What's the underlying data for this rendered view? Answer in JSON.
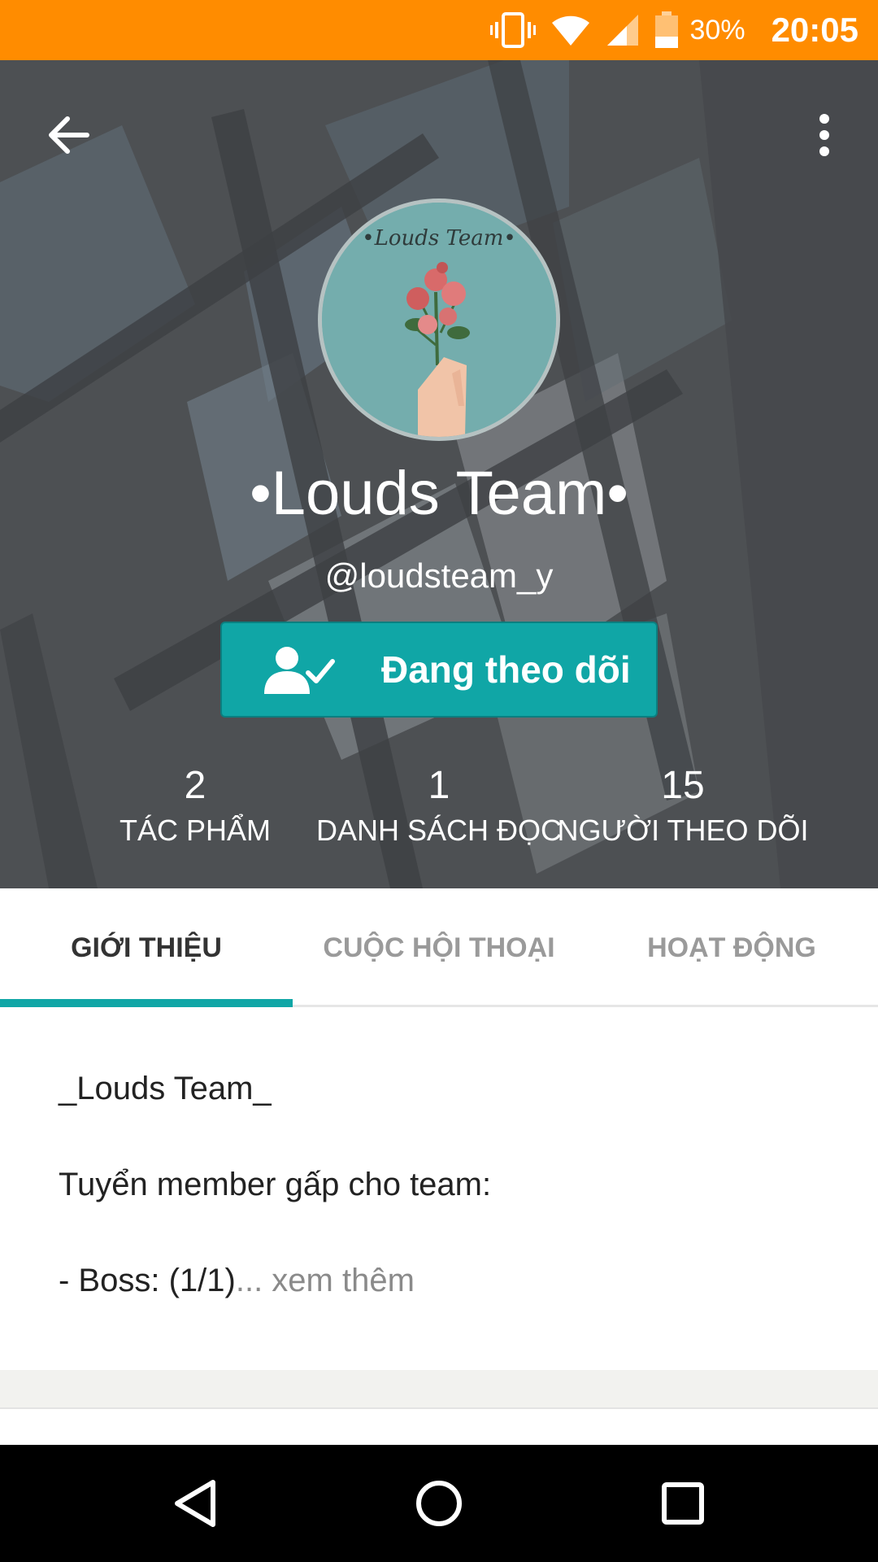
{
  "status_bar": {
    "battery_percent": "30%",
    "time": "20:05",
    "icons": [
      "vibrate-icon",
      "wifi-icon",
      "signal-icon",
      "battery-icon"
    ]
  },
  "header": {
    "back_icon": "arrow-left-icon",
    "menu_icon": "more-vertical-icon",
    "avatar_text": "•Louds Team•",
    "name": "•Louds Team•",
    "handle": "@loudsteam_y",
    "follow_button": {
      "label": "Đang theo dõi",
      "icon": "person-check-icon"
    }
  },
  "stats": [
    {
      "value": "2",
      "label": "TÁC PHẨM"
    },
    {
      "value": "1",
      "label": "DANH SÁCH ĐỌC"
    },
    {
      "value": "15",
      "label": "NGƯỜI THEO DÕI"
    }
  ],
  "tabs": [
    {
      "label": "GIỚI THIỆU",
      "active": true
    },
    {
      "label": "CUỘC HỘI THOẠI",
      "active": false
    },
    {
      "label": "HOẠT ĐỘNG",
      "active": false
    }
  ],
  "about": {
    "line1": "_Louds Team_",
    "line2": "Tuyển member gấp cho team:",
    "line3": "- Boss: (1/1)",
    "see_more": "... xem thêm"
  },
  "colors": {
    "status_bar": "#ff8c00",
    "accent": "#10a6a6",
    "nav_bar": "#000000"
  },
  "nav_bar": {
    "buttons": [
      "back-triangle-icon",
      "home-circle-icon",
      "recents-square-icon"
    ]
  }
}
